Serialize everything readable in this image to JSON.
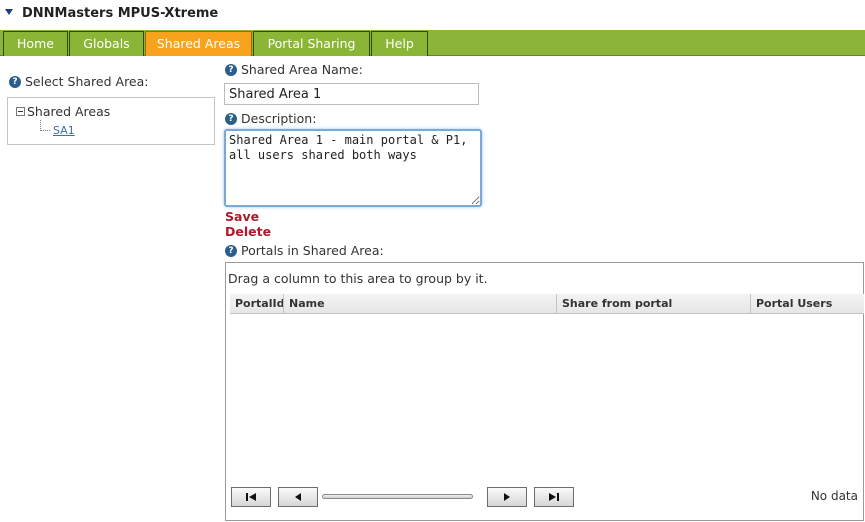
{
  "header": {
    "title": "DNNMasters MPUS-Xtreme"
  },
  "tabs": [
    {
      "label": "Home",
      "active": false
    },
    {
      "label": "Globals",
      "active": false
    },
    {
      "label": "Shared Areas",
      "active": true
    },
    {
      "label": "Portal Sharing",
      "active": false
    },
    {
      "label": "Help",
      "active": false
    }
  ],
  "left": {
    "select_label": "Select Shared Area:",
    "tree": {
      "root": "Shared Areas",
      "children": [
        "SA1"
      ]
    }
  },
  "form": {
    "name_label": "Shared Area Name:",
    "name_value": "Shared Area 1",
    "description_label": "Description:",
    "description_value": "Shared Area 1 - main portal & P1, all users shared both ways",
    "save_label": "Save",
    "delete_label": "Delete",
    "portals_label": "Portals in Shared Area:"
  },
  "grid": {
    "group_hint": "Drag a column to this area to group by it.",
    "columns": [
      "PortalId",
      "Name",
      "Share from portal",
      "Portal Users"
    ],
    "empty_text": "No data"
  },
  "icons": {
    "help": "help-icon",
    "pager": [
      "first-page-icon",
      "previous-page-icon",
      "next-page-icon",
      "last-page-icon"
    ]
  },
  "colors": {
    "tab_bar": "#8cb33a",
    "tab_active": "#f7a31e",
    "action_link": "#b2182b"
  }
}
